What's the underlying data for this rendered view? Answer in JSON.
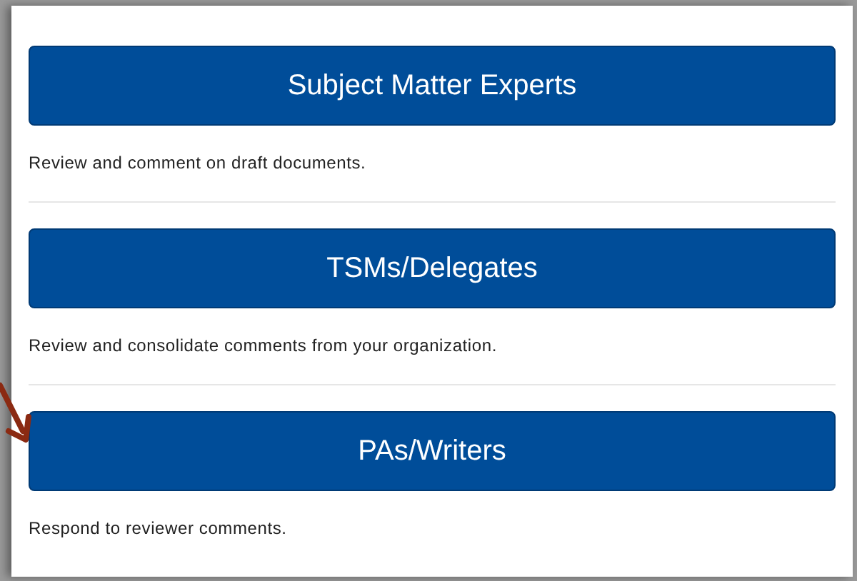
{
  "roles": [
    {
      "button": "Subject Matter Experts",
      "description": "Review and comment on draft documents."
    },
    {
      "button": "TSMs/Delegates",
      "description": "Review and consolidate comments from your organization."
    },
    {
      "button": "PAs/Writers",
      "description": "Respond to reviewer comments."
    }
  ]
}
